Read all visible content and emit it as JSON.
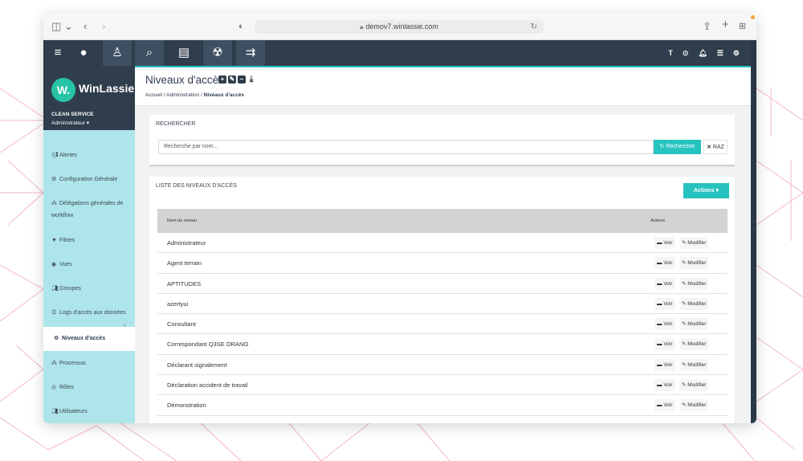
{
  "browser": {
    "url": "demov7.winlassie.com"
  },
  "brand": {
    "logo_letter": "W.",
    "name": "WinLassie",
    "company": "CLEAN SERVICE",
    "role": "Administrateur ▾"
  },
  "sidebar": {
    "items": [
      {
        "label": "Alertes",
        "icon": "bullhorn-icon"
      },
      {
        "label": "Configuration Générale",
        "icon": "cog-icon"
      },
      {
        "label": "Délégations générales de workflow",
        "icon": "sitemap-icon"
      },
      {
        "label": "Filtres",
        "icon": "filter-icon"
      },
      {
        "label": "Vues",
        "icon": "eye-icon"
      },
      {
        "label": "Groupes",
        "icon": "users-icon"
      },
      {
        "label": "Logs d'accès aux données",
        "icon": "list-icon"
      },
      {
        "label": "Niveaux d'accès",
        "icon": "access-icon"
      },
      {
        "label": "Processus",
        "icon": "sitemap-icon"
      },
      {
        "label": "Rôles",
        "icon": "user-circle-icon"
      },
      {
        "label": "Utilisateurs",
        "icon": "users-icon"
      }
    ]
  },
  "page": {
    "title": "Niveaux d'accès",
    "breadcrumb": {
      "home": "Accueil",
      "section": "Administration",
      "current": "Niveaux d'accès"
    }
  },
  "search": {
    "title": "RECHERCHER",
    "placeholder": "Recherche par nom...",
    "search_label": "Rechercher",
    "reset_label": "RAZ"
  },
  "list": {
    "title": "LISTE DES NIVEAUX D'ACCÈS",
    "actions_label": "Actions",
    "columns": [
      "Nom du niveau",
      "Actions"
    ],
    "view_label": "Voir",
    "edit_label": "Modifier",
    "rows": [
      "Administrateur",
      "Agent terrain",
      "APTITUDES",
      "azertyui",
      "Consultant",
      "Correspondant Q3SE ORANO",
      "Déclarant signalement",
      "Déclaration accident de travail",
      "Démonstration"
    ]
  },
  "colors": {
    "nav": "#2f3d4c",
    "accent": "#27c3c0",
    "sidebar": "#aee5ea",
    "logo": "#27c3a7"
  }
}
